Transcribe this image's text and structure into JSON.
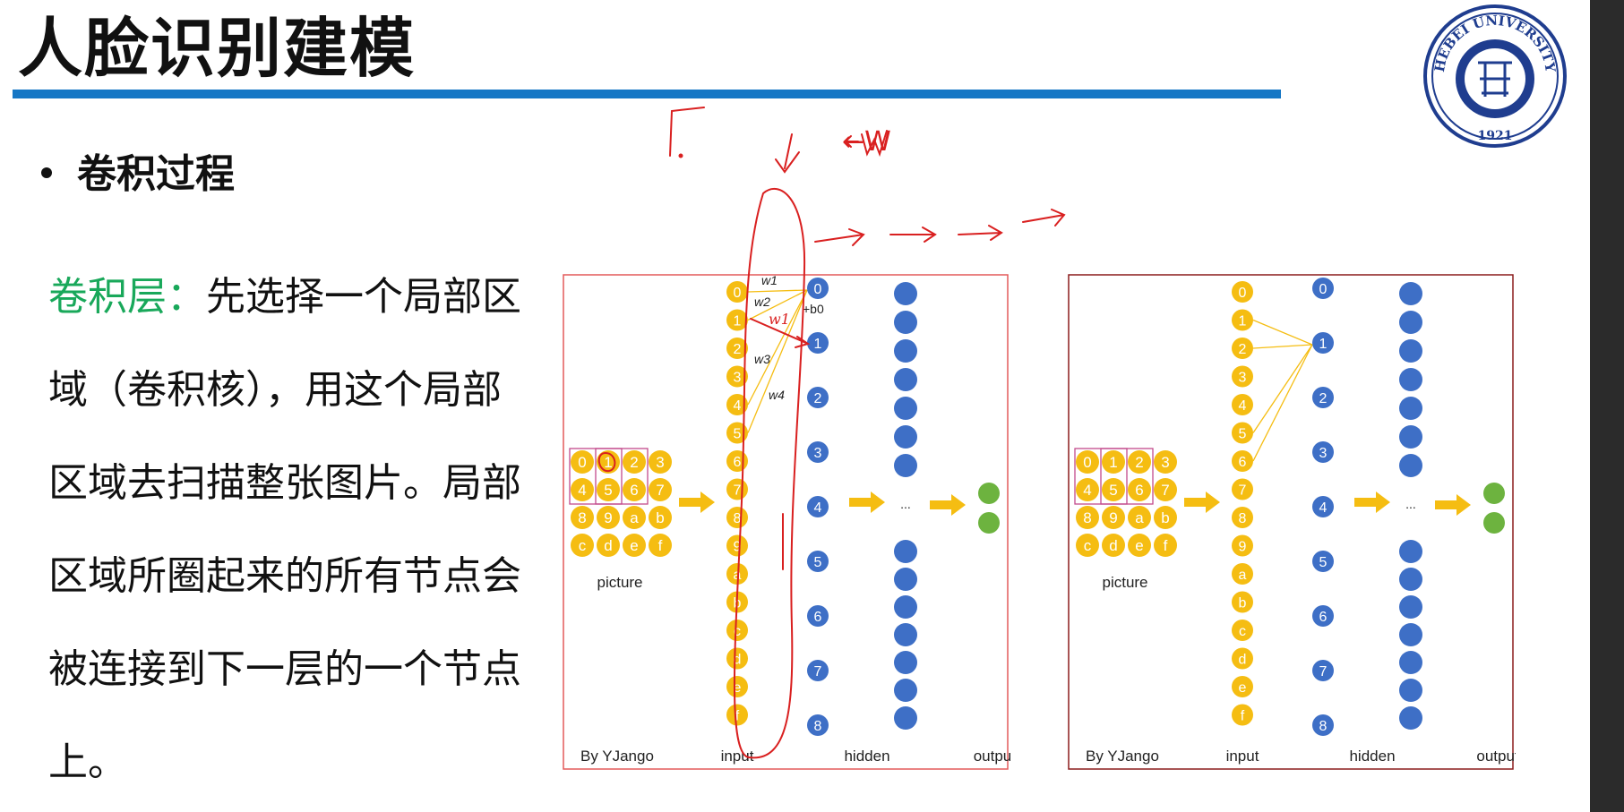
{
  "slide": {
    "title": "人脸识别建模",
    "bullet": "卷积过程",
    "paragraph_lead": "卷积层：",
    "paragraph_body": "先选择一个局部区域（卷积核），用这个局部区域去扫描整张图片。局部区域所圈起来的所有节点会被连接到下一层的一个节点上。"
  },
  "logo": {
    "text_top": "HEBEI UNIVERSITY",
    "year": "1921",
    "colors": {
      "ring": "#1f3d8f"
    }
  },
  "figures": [
    {
      "name": "left",
      "picture_cells": [
        "0",
        "1",
        "2",
        "3",
        "4",
        "5",
        "6",
        "7",
        "8",
        "9",
        "a",
        "b",
        "c",
        "d",
        "e",
        "f"
      ],
      "input_nodes": [
        "0",
        "1",
        "2",
        "3",
        "4",
        "5",
        "6",
        "7",
        "8",
        "9",
        "a",
        "b",
        "c",
        "d",
        "e",
        "f"
      ],
      "hidden_nodes": [
        "0",
        "1",
        "2",
        "3",
        "4",
        "5",
        "6",
        "7",
        "8"
      ],
      "weights": [
        "w1",
        "w2",
        "w3",
        "w4"
      ],
      "bias_label": "+b0",
      "labels": {
        "picture": "picture",
        "credit": "By YJango",
        "input": "input",
        "hidden": "hidden",
        "output": "outpu",
        "ellipsis": "..."
      },
      "annotation_w1": "w1",
      "annotation_w": "←W"
    },
    {
      "name": "right",
      "picture_cells": [
        "0",
        "1",
        "2",
        "3",
        "4",
        "5",
        "6",
        "7",
        "8",
        "9",
        "a",
        "b",
        "c",
        "d",
        "e",
        "f"
      ],
      "input_nodes": [
        "0",
        "1",
        "2",
        "3",
        "4",
        "5",
        "6",
        "7",
        "8",
        "9",
        "a",
        "b",
        "c",
        "d",
        "e",
        "f"
      ],
      "hidden_nodes": [
        "0",
        "1",
        "2",
        "3",
        "4",
        "5",
        "6",
        "7",
        "8"
      ],
      "labels": {
        "picture": "picture",
        "credit": "By YJango",
        "input": "input",
        "hidden": "hidden",
        "output": "output",
        "ellipsis": "..."
      }
    }
  ],
  "colors": {
    "title_rule": "#1677c5",
    "lead_text": "#19a85a",
    "node_yellow": "#f5bd12",
    "node_blue": "#3e6fc6",
    "node_green": "#6db33f",
    "frame": "#e35a5a",
    "frame_dark": "#8b1c1c",
    "kernel_box": "#c24a8c",
    "ink": "#d92020"
  }
}
